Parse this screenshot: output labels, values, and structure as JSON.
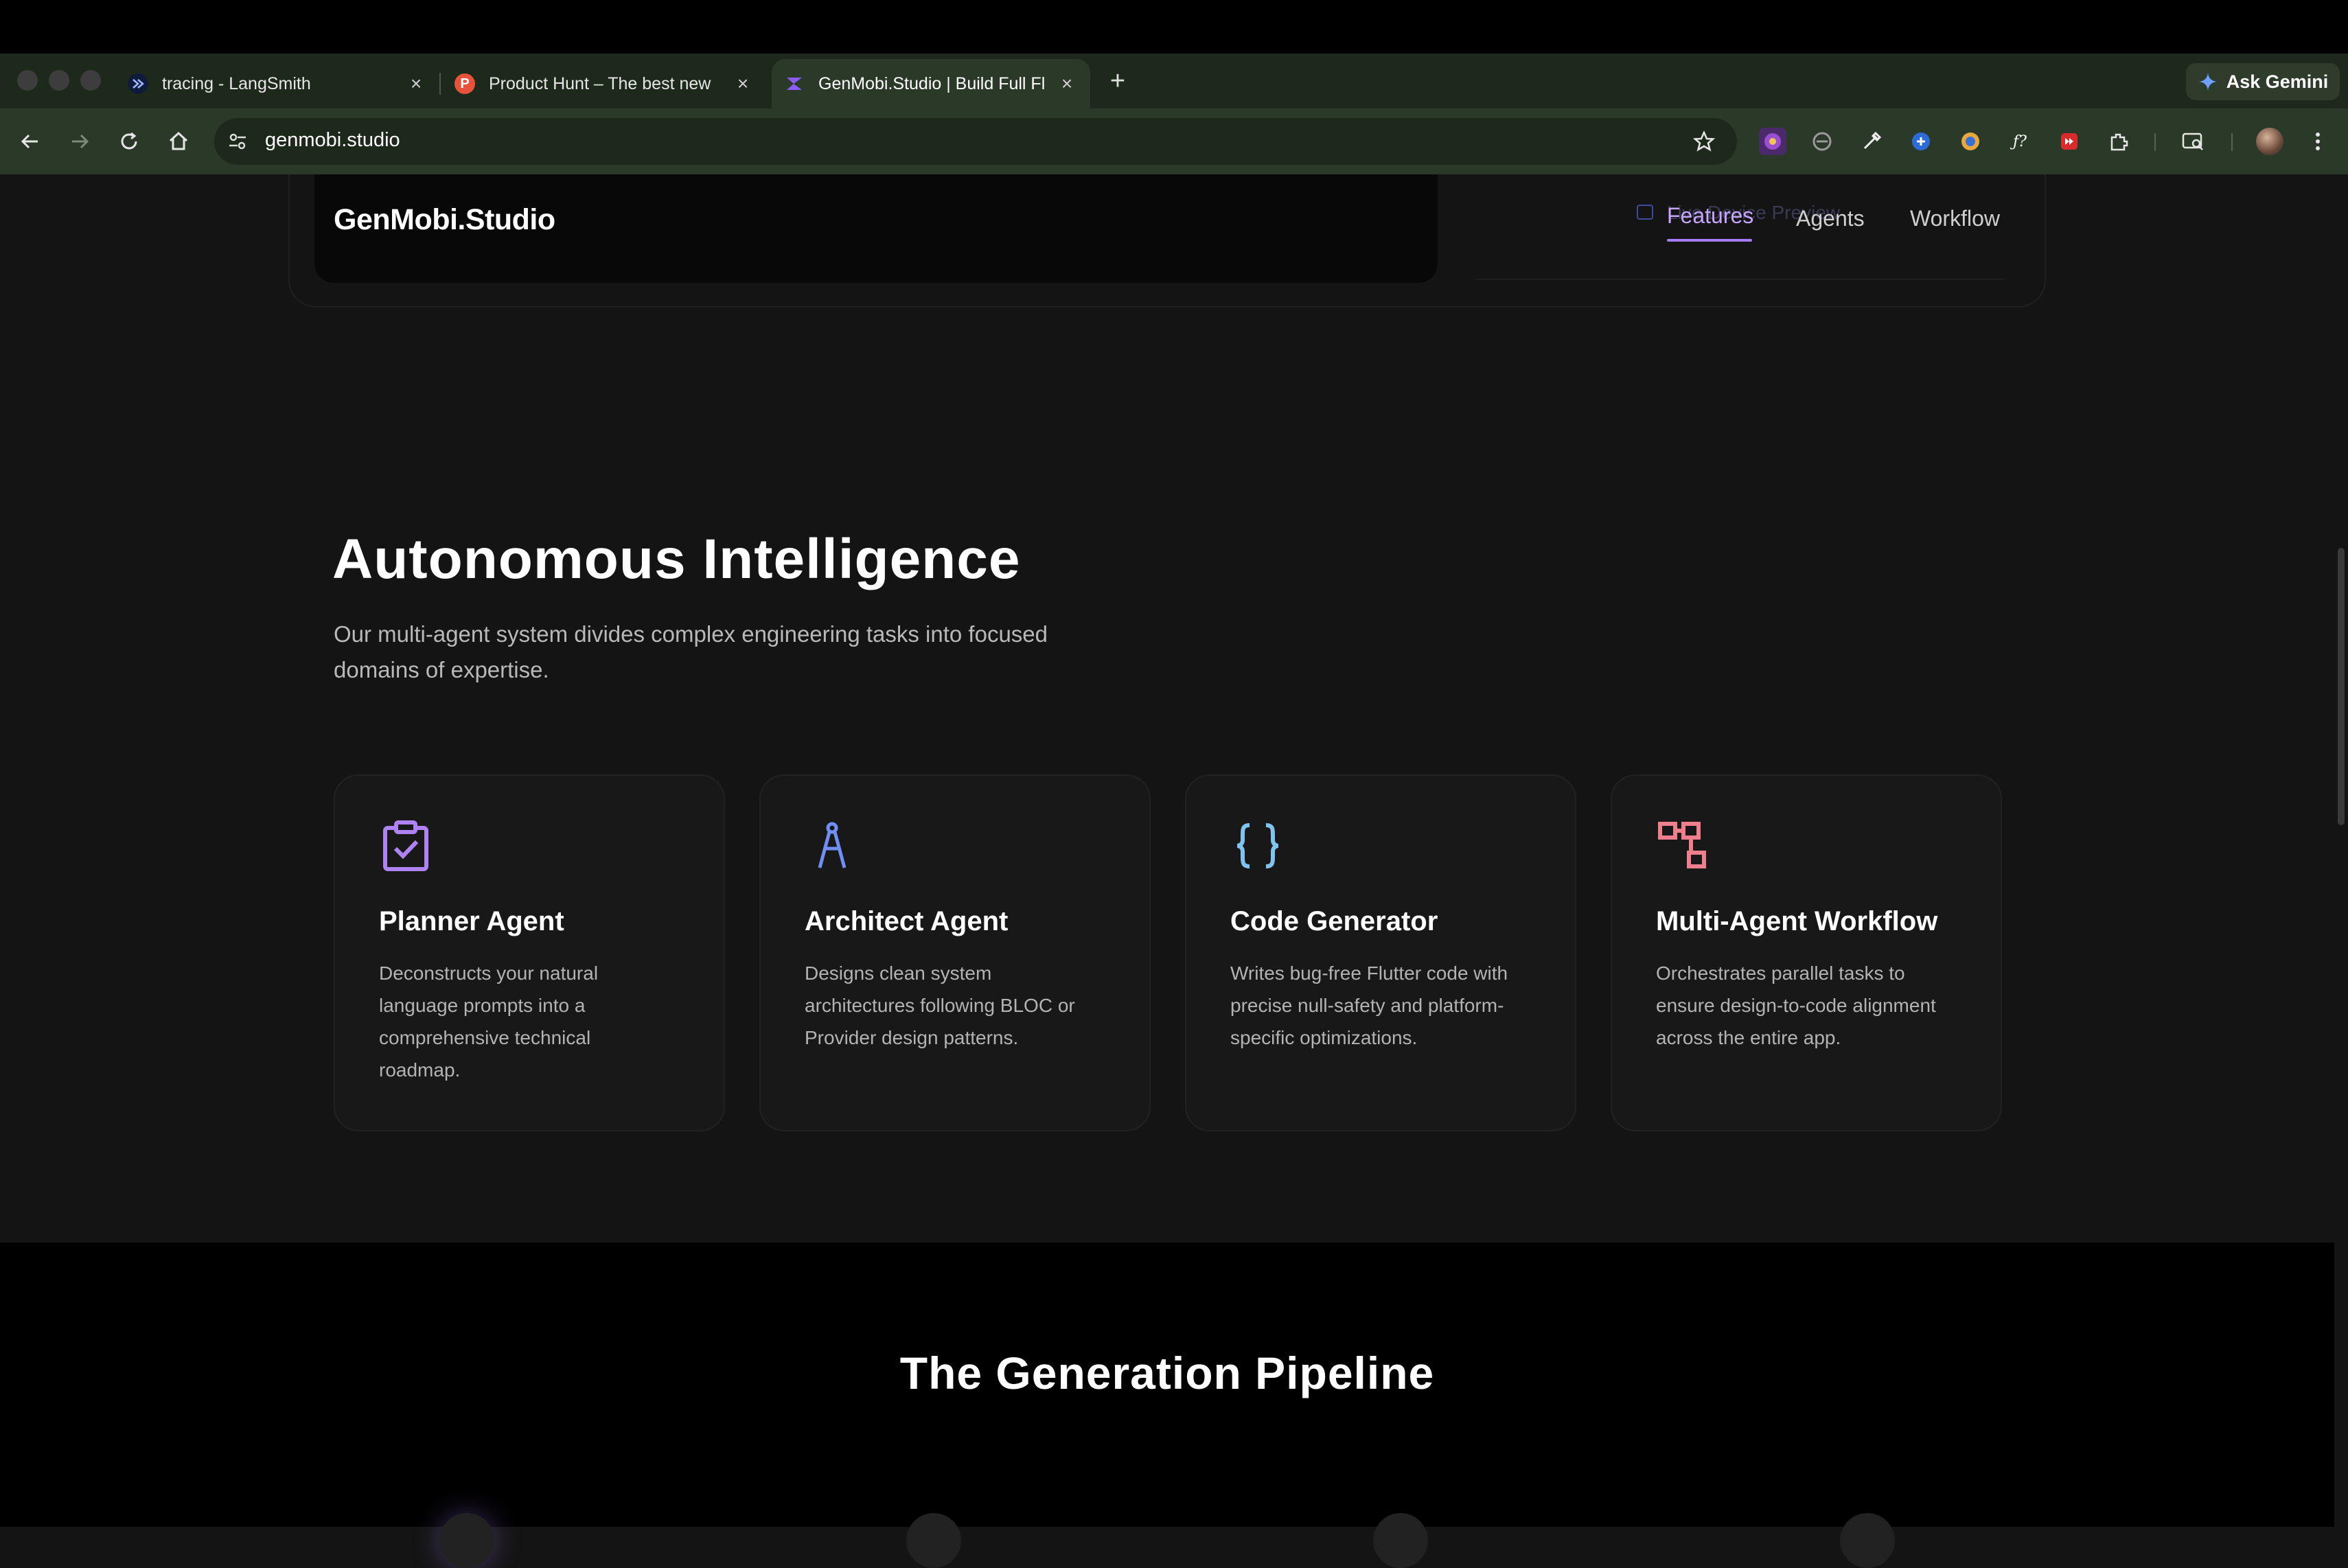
{
  "browser": {
    "tabs": [
      {
        "title": "tracing - LangSmith",
        "active": false
      },
      {
        "title": "Product Hunt – The best new",
        "favicon_letter": "P",
        "active": false
      },
      {
        "title": "GenMobi.Studio | Build Full Fl",
        "active": true
      }
    ],
    "new_tab_label": "+",
    "close_glyph": "×",
    "ask_gemini_label": "Ask Gemini",
    "address": "genmobi.studio",
    "icons": [
      "back-icon",
      "forward-icon",
      "reload-icon",
      "home-icon",
      "site-info-icon",
      "bookmark-star-icon",
      "extensions-icon",
      "reading-list-icon",
      "profile-avatar",
      "menu-icon"
    ]
  },
  "site": {
    "logo": "GenMobi.Studio",
    "nav": {
      "features": "Features",
      "agents": "Agents",
      "workflow": "Workflow"
    },
    "ghost_label": "Live Device Preview"
  },
  "intelligence": {
    "title": "Autonomous Intelligence",
    "description": "Our multi-agent system divides complex engineering tasks into focused domains of expertise.",
    "cards": [
      {
        "title": "Planner Agent",
        "body": "Deconstructs your natural language prompts into a comprehensive technical roadmap.",
        "icon": "clipboard-check-icon",
        "color": "#b083f5"
      },
      {
        "title": "Architect Agent",
        "body": "Designs clean system architectures following BLOC or Provider design patterns.",
        "icon": "compass-icon",
        "color": "#6f8ff2"
      },
      {
        "title": "Code Generator",
        "body": "Writes bug-free Flutter code with precise null-safety and platform-specific optimizations.",
        "icon": "curly-braces-icon",
        "color": "#7fc4ee"
      },
      {
        "title": "Multi-Agent Workflow",
        "body": "Orchestrates parallel tasks to ensure design-to-code alignment across the entire app.",
        "icon": "workflow-icon",
        "color": "#f07f8e"
      }
    ]
  },
  "pipeline": {
    "title": "The Generation Pipeline"
  },
  "colors": {
    "accent": "#a47cf7",
    "background": "#141414",
    "tab_strip": "#1d2a1b",
    "toolbar": "#2b3a28"
  }
}
